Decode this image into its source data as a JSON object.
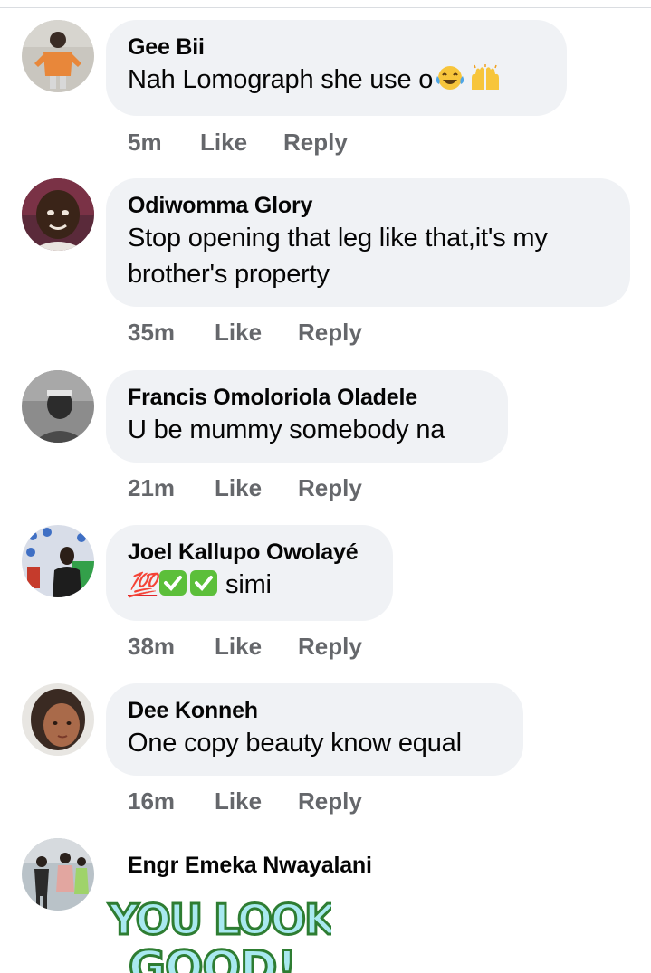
{
  "comments": [
    {
      "author": "Gee Bii",
      "text": "Nah Lomograph she use o",
      "time": "5m",
      "like": "Like",
      "reply": "Reply"
    },
    {
      "author": "Odiwomma Glory",
      "text_line1": "Stop opening that leg like that,it's my",
      "text_line2": "brother's property",
      "time": "35m",
      "like": "Like",
      "reply": "Reply"
    },
    {
      "author": "Francis Omoloriola Oladele",
      "text": "U be mummy somebody na",
      "time": "21m",
      "like": "Like",
      "reply": "Reply"
    },
    {
      "author": "Joel Kallupo Owolayé",
      "text": "simi",
      "emoji_text": "💯",
      "time": "38m",
      "like": "Like",
      "reply": "Reply"
    },
    {
      "author": "Dee Konneh",
      "text": "One copy beauty know equal",
      "time": "16m",
      "like": "Like",
      "reply": "Reply"
    },
    {
      "author": "Engr Emeka Nwayalani",
      "sticker_line1": "YOU LOOK",
      "sticker_line2": "GOOD!"
    }
  ],
  "icons": [
    "laughing-crying-emoji-icon",
    "raising-hands-emoji-icon",
    "hundred-points-emoji-icon",
    "check-mark-emoji-icon"
  ],
  "colors": {
    "bubble": "#f0f2f5",
    "meta": "#65676b",
    "text": "#050505",
    "sticker_fill": "#a9e9f0",
    "sticker_outline": "#2e7d32"
  }
}
